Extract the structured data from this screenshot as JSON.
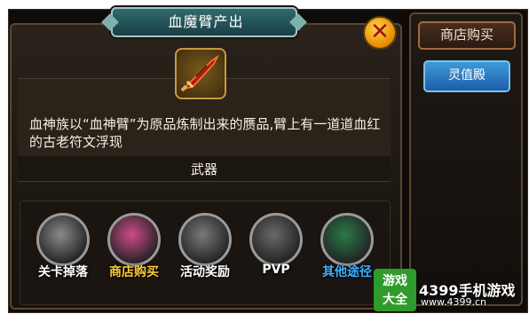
{
  "dialog": {
    "title": "血魔臂产出",
    "close_glyph": "✕",
    "item_icon": "sword-icon",
    "description": "血神族以“血神臂”为原品炼制出来的赝品,臂上有一道道血红的古老符文浮现",
    "item_type": "武器"
  },
  "sources": [
    {
      "label": "关卡掉落",
      "icon": "crossed-swords-icon",
      "color": "#ffffff"
    },
    {
      "label": "商店购买",
      "icon": "shop-bag-icon",
      "color": "#ffcc33"
    },
    {
      "label": "活动奖励",
      "icon": "treasure-chest-icon",
      "color": "#ffffff"
    },
    {
      "label": "PVP",
      "icon": "pvp-blade-icon",
      "color": "#ffffff"
    },
    {
      "label": "其他途径",
      "icon": "peacock-feather-icon",
      "color": "#3db2ff"
    }
  ],
  "side_panel": {
    "tab_label": "商店购买",
    "button_label": "灵值殿"
  },
  "watermark": {
    "logo_line1": "游戏",
    "logo_line2": "大全",
    "brand": "4399手机游戏",
    "url": "www.4399.cn"
  },
  "colors": {
    "accent_gold": "#c89a3a",
    "panel_border": "#5a4733",
    "title_teal": "#2f6a70",
    "button_blue": "#3f9ad8"
  }
}
